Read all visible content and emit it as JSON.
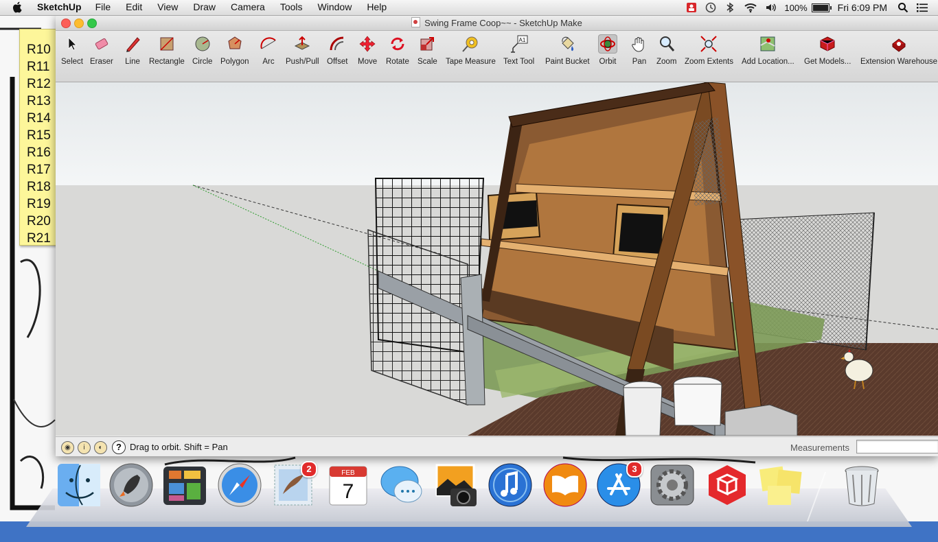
{
  "menubar": {
    "app_name": "SketchUp",
    "items": [
      "File",
      "Edit",
      "View",
      "Draw",
      "Camera",
      "Tools",
      "Window",
      "Help"
    ],
    "battery": "100%",
    "clock": "Fri 6:09 PM",
    "icons": [
      "apple-logo-icon",
      "notification-red-icon",
      "time-machine-icon",
      "bluetooth-icon",
      "wifi-icon",
      "volume-icon",
      "battery-icon",
      "spotlight-search-icon",
      "notification-center-icon"
    ]
  },
  "sticky_note": {
    "rows": [
      "R10",
      "R11",
      "R12",
      "R13",
      "R14",
      "R15",
      "R16",
      "R17",
      "R18",
      "R19",
      "R20",
      "R21"
    ]
  },
  "window": {
    "title": "Swing Frame Coop~~ - SketchUp Make",
    "toolbar": [
      {
        "label": "Select",
        "icon": "arrow-cursor-icon"
      },
      {
        "label": "Eraser",
        "icon": "eraser-icon"
      },
      {
        "label": "Line",
        "icon": "pencil-icon"
      },
      {
        "label": "Rectangle",
        "icon": "rectangle-icon"
      },
      {
        "label": "Circle",
        "icon": "circle-icon"
      },
      {
        "label": "Polygon",
        "icon": "polygon-icon"
      },
      {
        "label": "Arc",
        "icon": "arc-icon"
      },
      {
        "label": "Push/Pull",
        "icon": "push-pull-icon"
      },
      {
        "label": "Offset",
        "icon": "offset-icon"
      },
      {
        "label": "Move",
        "icon": "move-icon"
      },
      {
        "label": "Rotate",
        "icon": "rotate-icon"
      },
      {
        "label": "Scale",
        "icon": "scale-icon"
      },
      {
        "label": "Tape Measure",
        "icon": "tape-measure-icon"
      },
      {
        "label": "Text Tool",
        "icon": "text-tool-icon"
      },
      {
        "label": "Paint Bucket",
        "icon": "paint-bucket-icon"
      },
      {
        "label": "Orbit",
        "icon": "orbit-icon"
      },
      {
        "label": "Pan",
        "icon": "pan-hand-icon"
      },
      {
        "label": "Zoom",
        "icon": "zoom-magnifier-icon"
      },
      {
        "label": "Zoom Extents",
        "icon": "zoom-extents-icon"
      },
      {
        "label": "Add Location...",
        "icon": "add-location-icon"
      },
      {
        "label": "Get Models...",
        "icon": "get-models-icon"
      },
      {
        "label": "Extension Warehouse",
        "icon": "extension-warehouse-icon"
      }
    ],
    "text_tool_glyph": "A1",
    "active_tool": "Orbit",
    "status_hint": "Drag to orbit.  Shift = Pan",
    "help_glyph": "?",
    "measurements_label": "Measurements",
    "measurements_value": ""
  },
  "dock": {
    "items": [
      {
        "name": "Finder",
        "icon": "finder-icon"
      },
      {
        "name": "Launchpad",
        "icon": "launchpad-rocket-icon"
      },
      {
        "name": "Mission Control",
        "icon": "mission-control-icon"
      },
      {
        "name": "Safari",
        "icon": "safari-compass-icon"
      },
      {
        "name": "Mail",
        "icon": "mail-stamp-icon",
        "badge": "2"
      },
      {
        "name": "Calendar",
        "icon": "calendar-icon",
        "month": "FEB",
        "day": "7"
      },
      {
        "name": "Messages",
        "icon": "messages-bubble-icon"
      },
      {
        "name": "iPhoto",
        "icon": "iphoto-camera-icon"
      },
      {
        "name": "iTunes",
        "icon": "itunes-note-icon"
      },
      {
        "name": "iBooks",
        "icon": "ibooks-book-icon"
      },
      {
        "name": "App Store",
        "icon": "app-store-icon",
        "badge": "3"
      },
      {
        "name": "System Preferences",
        "icon": "system-preferences-gear-icon"
      },
      {
        "name": "SketchUp",
        "icon": "sketchup-logo-icon"
      },
      {
        "name": "Stickies",
        "icon": "stickies-notes-icon"
      },
      {
        "name": "Trash",
        "icon": "trash-can-icon"
      }
    ]
  }
}
